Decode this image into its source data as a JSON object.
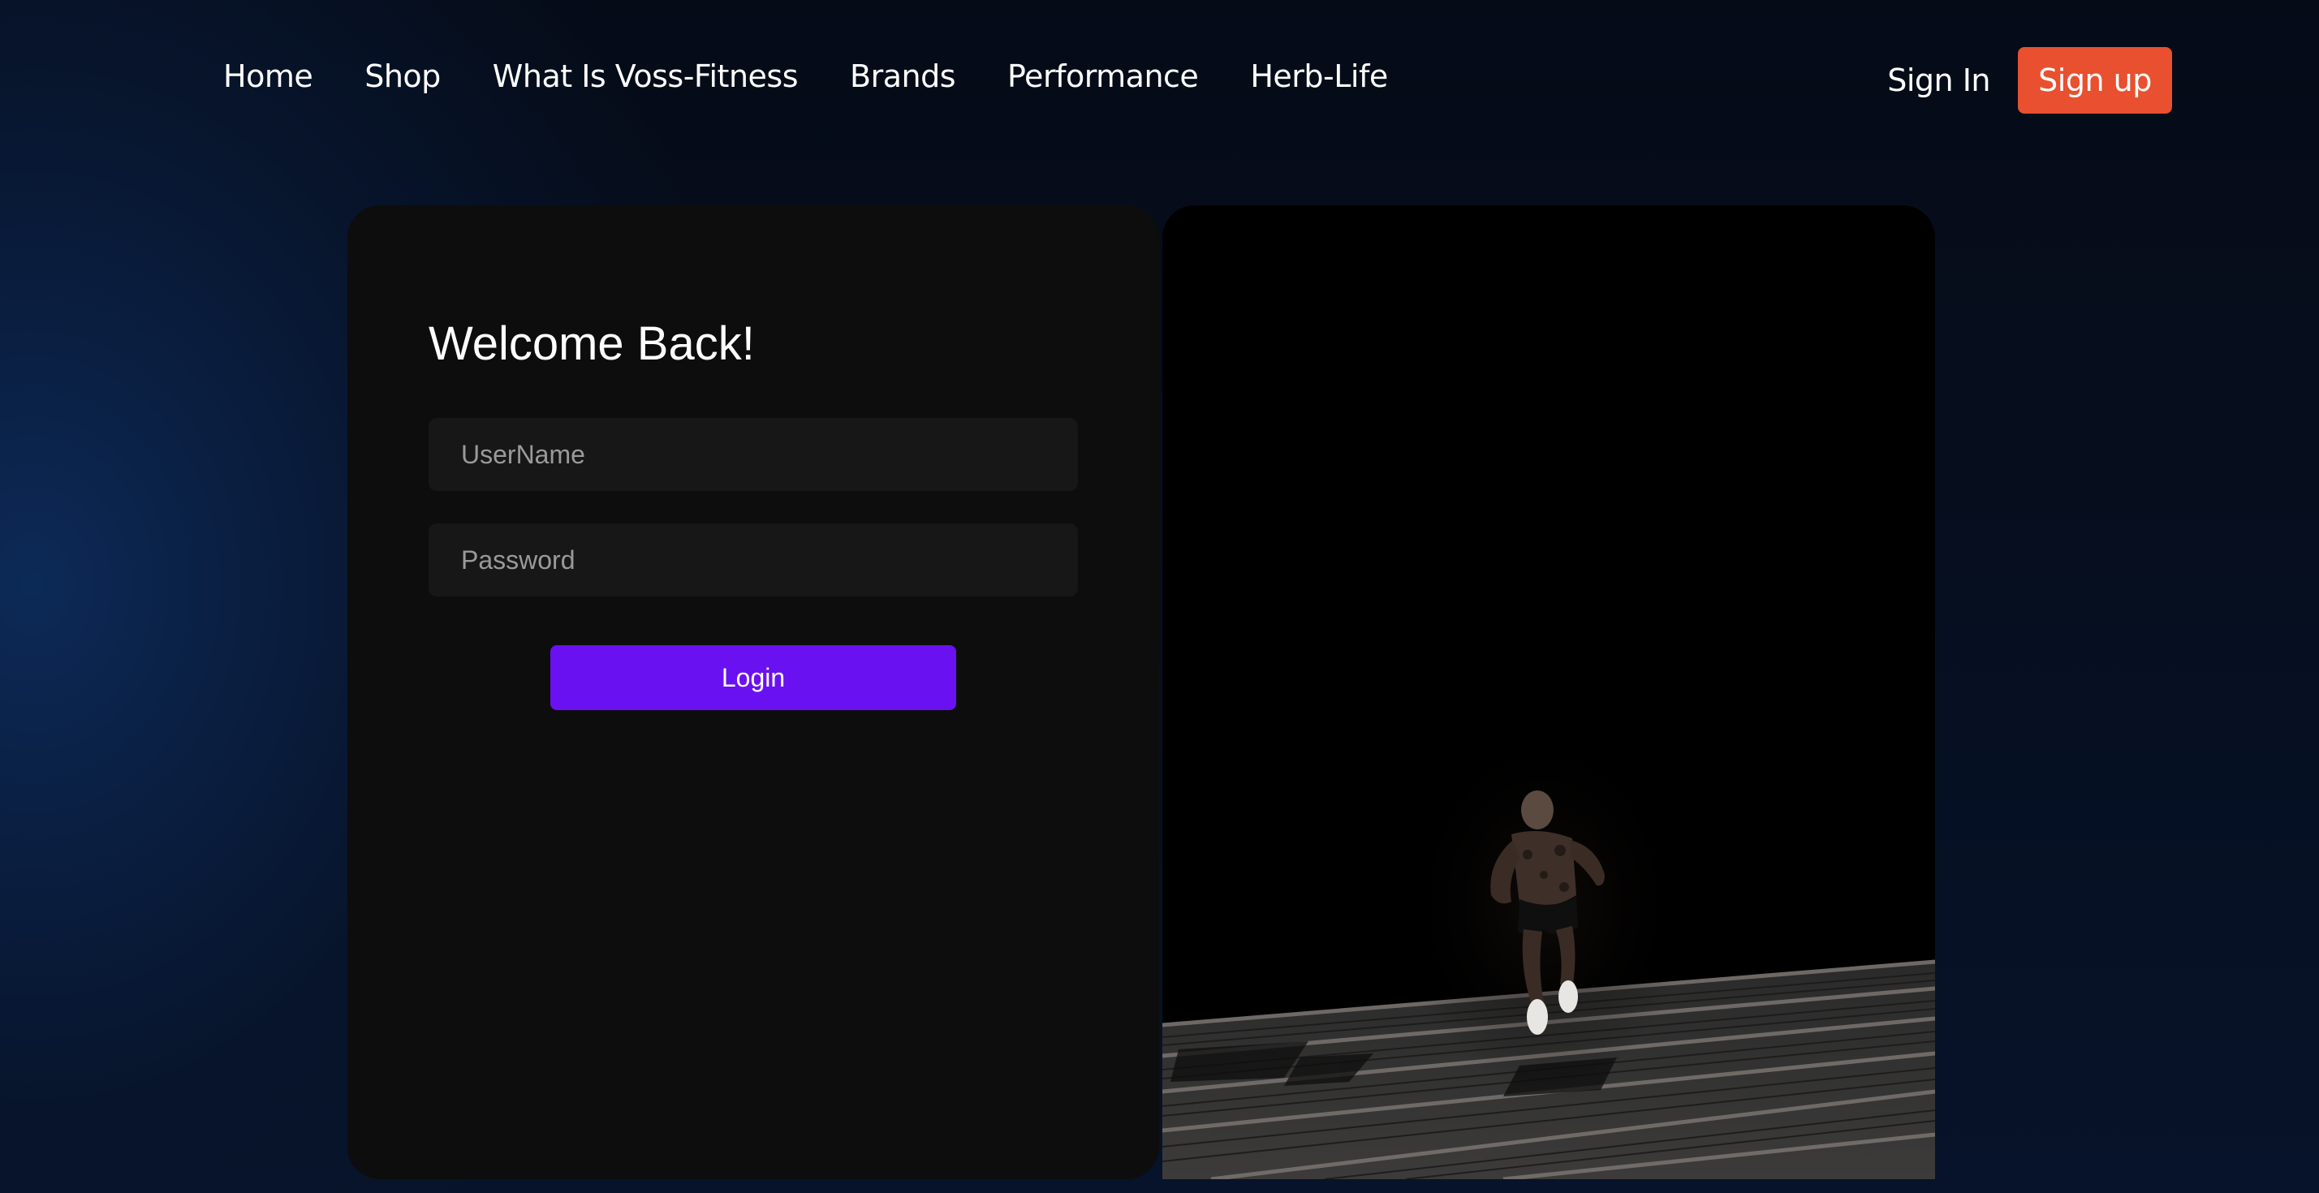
{
  "nav": {
    "links": [
      {
        "label": "Home"
      },
      {
        "label": "Shop"
      },
      {
        "label": "What Is Voss-Fitness"
      },
      {
        "label": "Brands"
      },
      {
        "label": "Performance"
      },
      {
        "label": "Herb-Life"
      }
    ],
    "sign_in_label": "Sign In",
    "sign_up_label": "Sign up"
  },
  "login": {
    "title": "Welcome Back!",
    "username": {
      "placeholder": "UserName",
      "value": ""
    },
    "password": {
      "placeholder": "Password",
      "value": ""
    },
    "submit_label": "Login"
  },
  "colors": {
    "sign_up_bg": "#e8502f",
    "login_button_bg": "#6a11f2",
    "card_bg": "#0d0d0d",
    "field_bg": "#171717",
    "page_bg": "#050b18"
  },
  "image": {
    "subject": "athlete-running-up-stairs"
  }
}
